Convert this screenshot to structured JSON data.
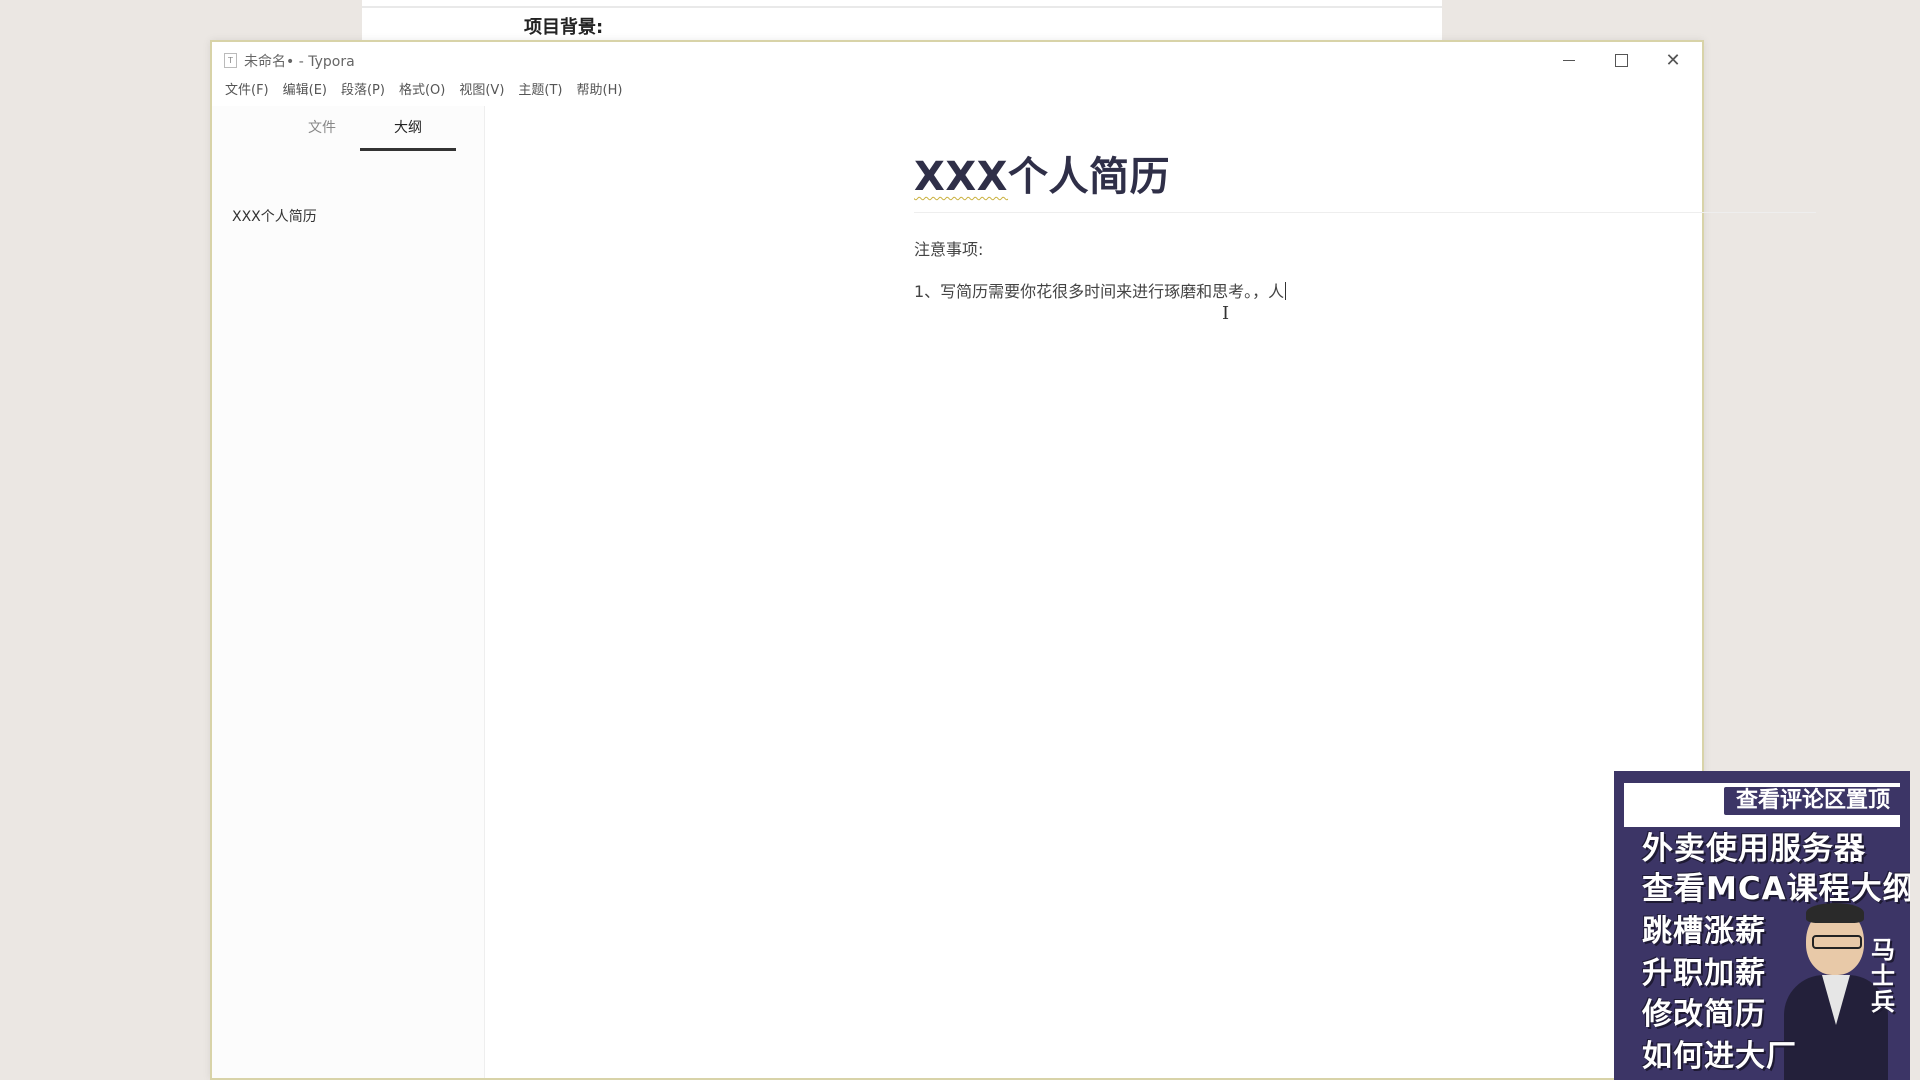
{
  "background_doc": {
    "heading": "项目背景:"
  },
  "window": {
    "title": "未命名• - Typora",
    "controls": {
      "minimize": "minimize",
      "maximize": "maximize",
      "close": "✕"
    }
  },
  "menu": [
    "文件(F)",
    "编辑(E)",
    "段落(P)",
    "格式(O)",
    "视图(V)",
    "主题(T)",
    "帮助(H)"
  ],
  "sidebar": {
    "tabs": {
      "files": "文件",
      "outline": "大纲"
    },
    "active_tab": "outline",
    "outline_items": [
      "XXX个人简历"
    ]
  },
  "document": {
    "title_prefix": "XXX",
    "title_rest": "个人简历",
    "paragraphs": [
      "注意事项:",
      "1、写简历需要你花很多时间来进行琢磨和思考。，人"
    ]
  },
  "promo": {
    "banner": "查看评论区置顶",
    "lines": [
      "外卖使用服务器",
      "查看MCA课程大纲",
      "跳槽涨薪",
      "升职加薪",
      "修改简历",
      "如何进大厂"
    ],
    "name": "马士兵"
  },
  "colors": {
    "title": "#2f2f48",
    "window_border": "#d8d3a8",
    "promo_bg": "#3c3566"
  }
}
